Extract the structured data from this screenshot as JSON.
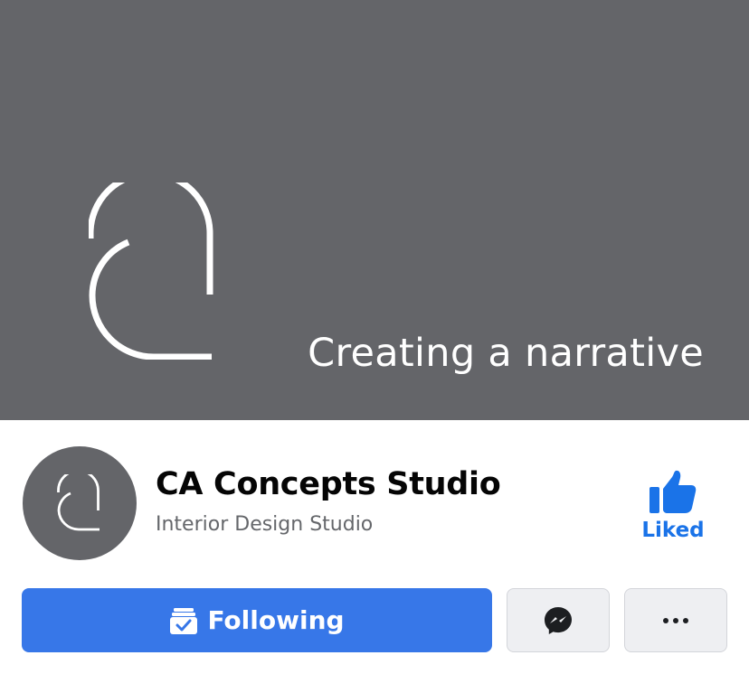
{
  "cover": {
    "tagline": "Creating a narrative",
    "background_color": "#646569",
    "logo_icon": "ca-monogram-icon"
  },
  "profile": {
    "name": "CA Concepts Studio",
    "category": "Interior Design Studio",
    "avatar_icon": "ca-monogram-icon"
  },
  "like_action": {
    "label": "Liked",
    "icon": "thumbs-up-icon",
    "color": "#1a73e8"
  },
  "actions": {
    "following_label": "Following",
    "following_icon": "inbox-check-icon",
    "primary_color": "#3777e8",
    "messenger_icon": "messenger-icon",
    "more_icon": "more-dots-icon"
  }
}
